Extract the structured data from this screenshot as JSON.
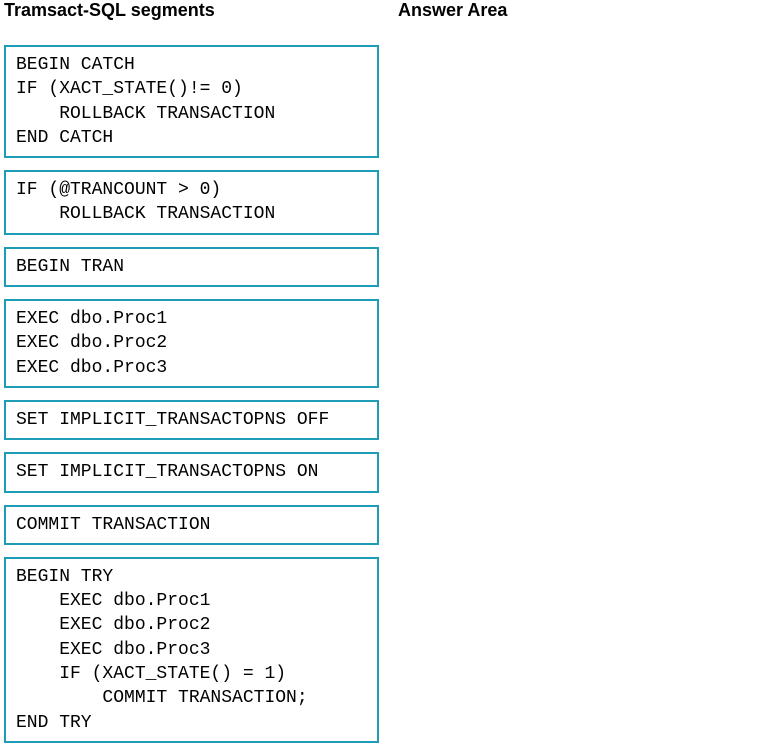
{
  "headers": {
    "left": "Tramsact-SQL segments",
    "right": "Answer Area"
  },
  "segments": [
    "BEGIN CATCH\nIF (XACT_STATE()!= 0)\n    ROLLBACK TRANSACTION\nEND CATCH",
    "IF (@TRANCOUNT > 0)\n    ROLLBACK TRANSACTION",
    "BEGIN TRAN",
    "EXEC dbo.Proc1\nEXEC dbo.Proc2\nEXEC dbo.Proc3",
    "SET IMPLICIT_TRANSACTOPNS OFF",
    "SET IMPLICIT_TRANSACTOPNS ON",
    "COMMIT TRANSACTION",
    "BEGIN TRY\n    EXEC dbo.Proc1\n    EXEC dbo.Proc2\n    EXEC dbo.Proc3\n    IF (XACT_STATE() = 1)\n        COMMIT TRANSACTION;\nEND TRY"
  ]
}
